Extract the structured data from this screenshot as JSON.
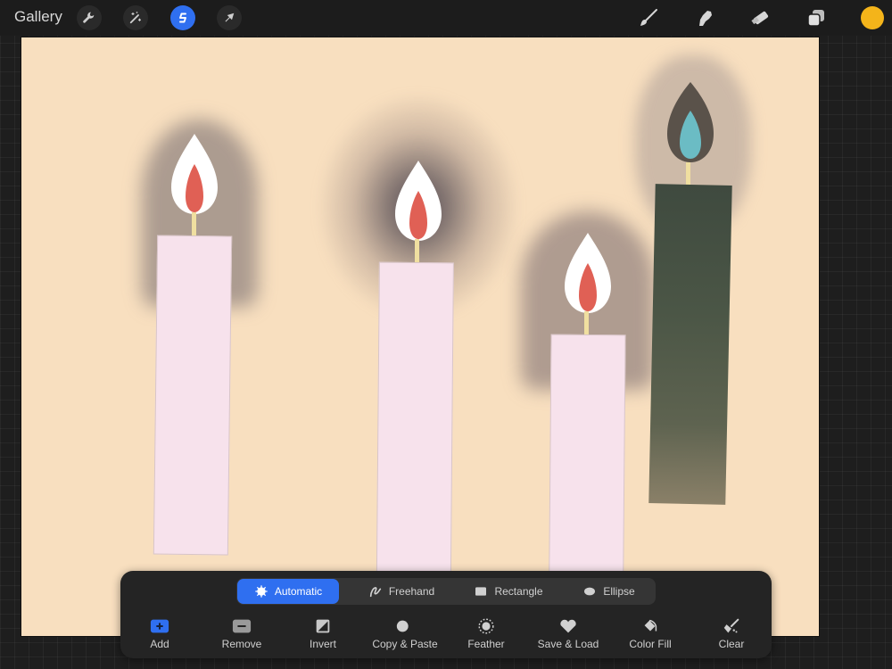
{
  "topbar": {
    "gallery_label": "Gallery",
    "left_tools": [
      {
        "name": "actions",
        "icon": "wrench-icon",
        "active": false
      },
      {
        "name": "adjustments",
        "icon": "magic-wand-icon",
        "active": false
      },
      {
        "name": "selection",
        "icon": "selection-s-icon",
        "active": true
      },
      {
        "name": "transform",
        "icon": "arrow-cursor-icon",
        "active": false
      }
    ],
    "right_tools": [
      {
        "name": "brush",
        "icon": "brush-icon"
      },
      {
        "name": "smudge",
        "icon": "smudge-finger-icon"
      },
      {
        "name": "eraser",
        "icon": "eraser-icon"
      },
      {
        "name": "layers",
        "icon": "layers-icon"
      }
    ],
    "current_color": "#f4b41a"
  },
  "canvas": {
    "background_color": "#f8dfbf",
    "candles": [
      {
        "name": "candle-1",
        "body_color": "#f7e2ec",
        "flame_outer": "#ffffff",
        "flame_inner": "#e06055",
        "glow": "grey-shadow"
      },
      {
        "name": "candle-2",
        "body_color": "#f7e2ec",
        "flame_outer": "#ffffff",
        "flame_inner": "#e06055",
        "glow": "soft-radial"
      },
      {
        "name": "candle-3",
        "body_color": "#f7e2ec",
        "flame_outer": "#ffffff",
        "flame_inner": "#e06055",
        "glow": "grey-shadow"
      },
      {
        "name": "candle-4",
        "body_color": "#4b5244",
        "flame_outer": "#5a524a",
        "flame_inner": "#6bbcc4",
        "glow": "textured-grey"
      }
    ]
  },
  "selection_toolbar": {
    "modes": [
      {
        "label": "Automatic",
        "icon": "sunburst-icon",
        "active": true
      },
      {
        "label": "Freehand",
        "icon": "freehand-scribble-icon",
        "active": false
      },
      {
        "label": "Rectangle",
        "icon": "rectangle-icon",
        "active": false
      },
      {
        "label": "Ellipse",
        "icon": "ellipse-icon",
        "active": false
      }
    ],
    "actions": [
      {
        "label": "Add",
        "icon": "plus-box-icon"
      },
      {
        "label": "Remove",
        "icon": "minus-box-icon"
      },
      {
        "label": "Invert",
        "icon": "invert-icon"
      },
      {
        "label": "Copy & Paste",
        "icon": "copy-paste-icon"
      },
      {
        "label": "Feather",
        "icon": "feather-icon"
      },
      {
        "label": "Save & Load",
        "icon": "heart-icon"
      },
      {
        "label": "Color Fill",
        "icon": "paint-bucket-icon"
      },
      {
        "label": "Clear",
        "icon": "broom-icon"
      }
    ],
    "accent_color": "#2f6ff0"
  }
}
